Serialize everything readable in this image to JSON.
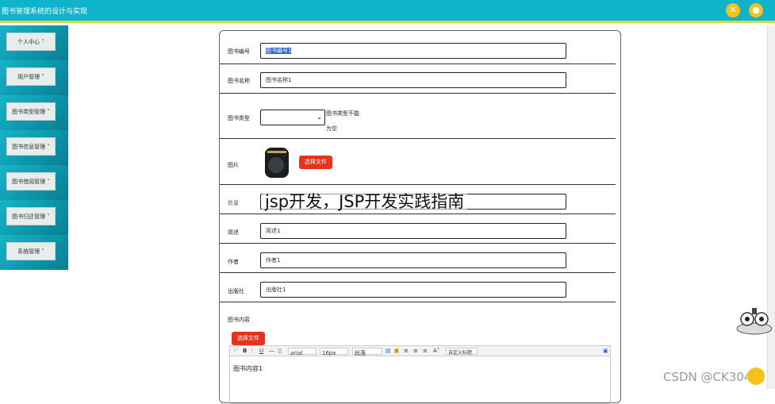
{
  "app": {
    "title": "图书管理系统的设计与实现"
  },
  "header": {
    "close_icon": "close-icon",
    "user_icon": "user-icon",
    "accent": "#0fb3cc",
    "button_color": "#f2c41c"
  },
  "sidebar": {
    "items": [
      {
        "label": "个人中心"
      },
      {
        "label": "用户管理"
      },
      {
        "label": "图书类型管理"
      },
      {
        "label": "图书信息管理"
      },
      {
        "label": "图书借阅管理"
      },
      {
        "label": "图书归还管理"
      },
      {
        "label": "系统管理"
      }
    ]
  },
  "form": {
    "book_no": {
      "label": "图书编号",
      "value": "图书编号1"
    },
    "book_name": {
      "label": "图书名称",
      "value": "图书名称1"
    },
    "book_type": {
      "label": "图书类型",
      "value": "",
      "error": "图书类型不能为空"
    },
    "picture": {
      "label": "图片",
      "button": "选择文件"
    },
    "count": {
      "label": "数量",
      "value": ""
    },
    "summary": {
      "label": "简述",
      "value": "简述1"
    },
    "author": {
      "label": "作者",
      "value": "作者1"
    },
    "publisher": {
      "label": "出版社",
      "value": "出版社1"
    },
    "content": {
      "label": "图书内容",
      "button": "选择文件",
      "value": "图书内容1"
    },
    "toolbar": {
      "font": "arial",
      "size": "16px",
      "heading": "段落",
      "style": "自定义标题"
    }
  },
  "watermark": "jsp开发，JSP开发实践指南",
  "credit": "CSDN @CK3042"
}
